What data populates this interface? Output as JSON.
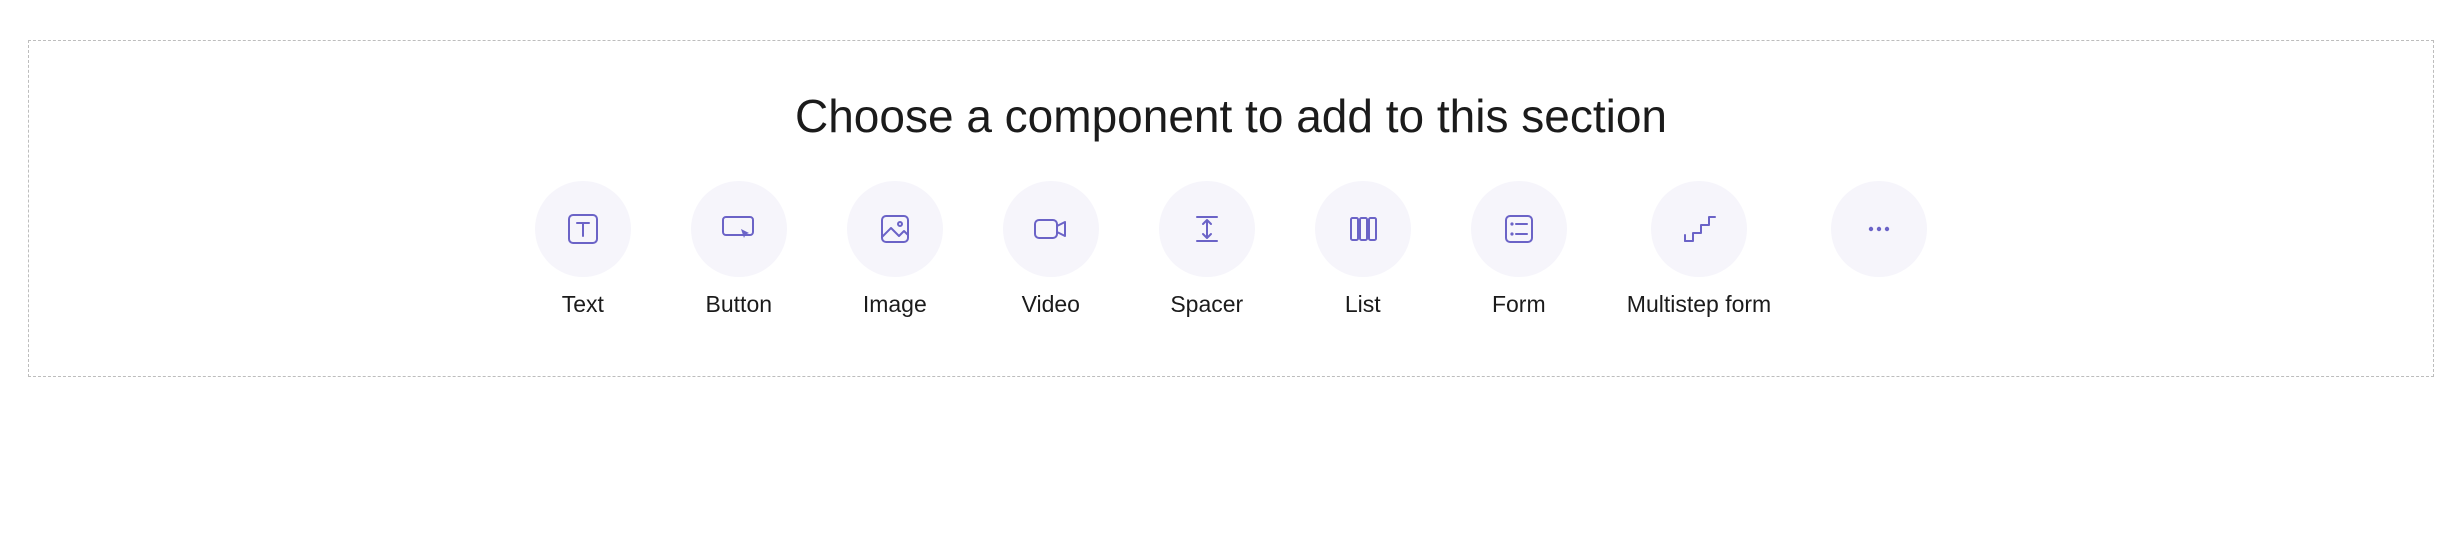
{
  "heading": "Choose a component to add to this section",
  "colors": {
    "accent": "#6b63c7",
    "circle_bg": "#f6f5fb"
  },
  "components": {
    "text": {
      "label": "Text",
      "icon": "text-icon"
    },
    "button": {
      "label": "Button",
      "icon": "button-cursor-icon"
    },
    "image": {
      "label": "Image",
      "icon": "image-icon"
    },
    "video": {
      "label": "Video",
      "icon": "video-camera-icon"
    },
    "spacer": {
      "label": "Spacer",
      "icon": "spacer-vertical-icon"
    },
    "list": {
      "label": "List",
      "icon": "columns-icon"
    },
    "form": {
      "label": "Form",
      "icon": "form-fields-icon"
    },
    "multistep_form": {
      "label": "Multistep form",
      "icon": "steps-icon"
    },
    "more": {
      "label": "",
      "icon": "more-ellipsis-icon"
    }
  }
}
